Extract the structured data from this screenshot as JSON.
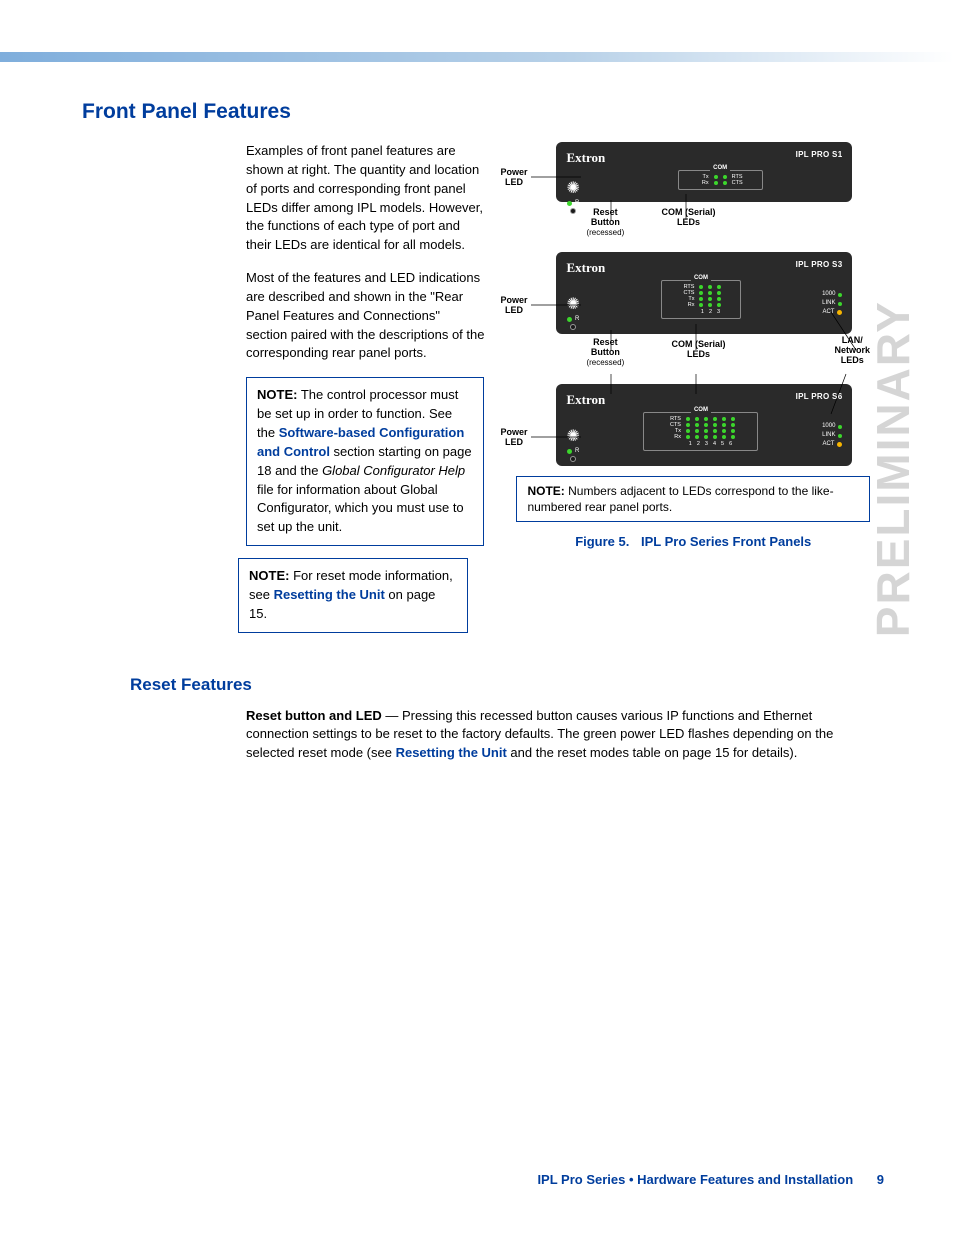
{
  "watermark": "PRELIMINARY",
  "section_title": "Front Panel Features",
  "para1": "Examples of front panel features are shown at right. The quantity and location of ports and corresponding front panel LEDs differ among IPL models. However, the functions of each type of port and their LEDs are identical for all models.",
  "para2": "Most of the features and LED indications are described and shown in the \"Rear Panel Features and Connections\" section paired with the descriptions of the corresponding rear panel ports.",
  "note1": {
    "label": "NOTE:",
    "pre": " The control processor must be set up in order to function. See the ",
    "link": "Software-based Configuration and Control",
    "mid": " section starting on page 18 and the ",
    "italic": "Global Configurator Help",
    "post": " file for information about Global Configurator, which you must use to set up the unit."
  },
  "note2": {
    "label": "NOTE:",
    "pre": " For reset mode information, see ",
    "link": "Resetting the Unit",
    "post": " on page 15."
  },
  "diagram": {
    "brand": "Extron",
    "models": {
      "s1": "IPL PRO S1",
      "s3": "IPL PRO S3",
      "s6": "IPL PRO S6"
    },
    "power_led": "Power\nLED",
    "reset_button": "Reset\nButton",
    "recessed": "(recessed)",
    "com_leds": "COM (Serial)\nLEDs",
    "lan_leds": "LAN/\nNetwork\nLEDs",
    "com_title": "COM",
    "signals": {
      "tx": "Tx",
      "rx": "Rx",
      "rts": "RTS",
      "cts": "CTS"
    },
    "r_label": "R",
    "lan": {
      "l1000": "1000",
      "link": "LINK",
      "act": "ACT"
    },
    "nums_s3": [
      "1",
      "2",
      "3"
    ],
    "nums_s6": [
      "1",
      "2",
      "3",
      "4",
      "5",
      "6"
    ],
    "note": {
      "label": "NOTE:",
      "text": " Numbers adjacent to LEDs correspond to the like-numbered rear panel ports."
    },
    "figure_num": "Figure 5.",
    "figure_title": "IPL Pro Series Front Panels"
  },
  "reset": {
    "title": "Reset Features",
    "lead": "Reset button and LED",
    "sep": " — ",
    "body1": "Pressing this recessed button causes various IP functions and Ethernet connection settings to be reset to the factory defaults. The green power LED flashes depending on the selected reset mode (see ",
    "link": "Resetting the Unit",
    "body2": " and the reset modes table on page 15 for details)."
  },
  "footer": {
    "text": "IPL Pro Series • Hardware Features and Installation",
    "page": "9"
  }
}
